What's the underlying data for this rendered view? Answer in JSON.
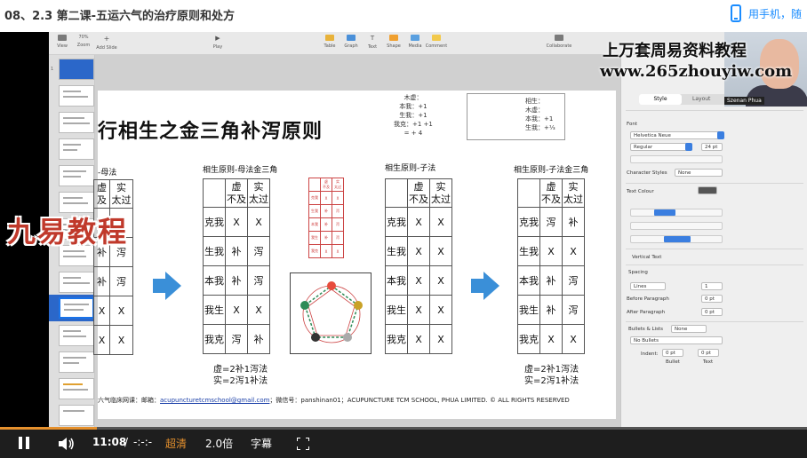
{
  "course_title": "08、2.3 第二课-五运六气的治疗原则和处方",
  "phone_link": "用手机，随",
  "toolbar": {
    "view": "View",
    "zoom": "Zoom",
    "zoom_value": "70%",
    "add_slide": "Add Slide",
    "play": "Play",
    "table": "Table",
    "graph": "Graph",
    "text": "Text",
    "shape": "Shape",
    "media": "Media",
    "comment": "Comment",
    "collaborate": "Collaborate"
  },
  "watermark": {
    "line1": "上万套周易资料教程",
    "line2": "www.265zhouyiw.com"
  },
  "presenter_name": "Szenan Phua",
  "logo_overlay": "九易教程",
  "slide": {
    "title": "行相生之金三角补泻原则",
    "note_left": [
      "木虚：",
      "本我：+1",
      "生我：+1",
      "我克：+1 +1",
      "= + 4"
    ],
    "note_right": [
      "相生：",
      "木虚：",
      "本我：+1",
      "生我：+⅓"
    ],
    "tables": [
      {
        "heading": "-母法",
        "headers": [
          "虚\n不及",
          "实\n太过"
        ],
        "rows": [
          [
            "",
            ""
          ],
          [
            "",
            ""
          ],
          [
            "补",
            "泻"
          ],
          [
            "补",
            "泻"
          ],
          [
            "X",
            "X"
          ],
          [
            "X",
            "X"
          ]
        ]
      },
      {
        "heading": "相生原则-母法金三角",
        "headers": [
          "虚\n不及",
          "实\n太过"
        ],
        "rows": [
          [
            "克我",
            "X",
            "X"
          ],
          [
            "生我",
            "补",
            "泻"
          ],
          [
            "本我",
            "补",
            "泻"
          ],
          [
            "我生",
            "X",
            "X"
          ],
          [
            "我克",
            "泻",
            "补"
          ]
        ]
      },
      {
        "heading": "相生原则-子法",
        "headers": [
          "虚\n不及",
          "实\n太过"
        ],
        "rows": [
          [
            "克我",
            "X",
            "X"
          ],
          [
            "生我",
            "X",
            "X"
          ],
          [
            "本我",
            "X",
            "X"
          ],
          [
            "我生",
            "X",
            "X"
          ],
          [
            "我克",
            "X",
            "X"
          ]
        ]
      },
      {
        "heading": "相生原则-子法金三角",
        "headers": [
          "虚\n不及",
          "实\n太过"
        ],
        "rows": [
          [
            "克我",
            "泻",
            "补"
          ],
          [
            "生我",
            "X",
            "X"
          ],
          [
            "本我",
            "补",
            "泻"
          ],
          [
            "我生",
            "补",
            "泻"
          ],
          [
            "我克",
            "X",
            "X"
          ]
        ]
      }
    ],
    "formula_left": [
      "虚=2补1泻法",
      "实=2泻1补法"
    ],
    "formula_right": [
      "虚=2补1泻法",
      "实=2泻1补法"
    ],
    "footer_prefix": "六气临床网课：邮箱：",
    "footer_email": "acupuncturetcmschool@gmail.com",
    "footer_suffix": "；微信号：panshinan01；ACUPUNCTURE TCM SCHOOL, PHUA LIMITED. © ALL RIGHTS RESERVED"
  },
  "inspector": {
    "tab_style": "Style",
    "tab_layout": "Layout",
    "font_label": "Font",
    "font_name": "Helvetica Neue",
    "font_weight": "Regular",
    "font_size": "24 pt",
    "character_styles": "Character Styles",
    "character_styles_value": "None",
    "text_colour": "Text Colour",
    "vertical_text": "Vertical Text",
    "spacing_label": "Spacing",
    "spacing_mode": "Lines",
    "spacing_value": "1",
    "before_paragraph": "Before Paragraph",
    "before_value": "0 pt",
    "after_paragraph": "After Paragraph",
    "after_value": "0 pt",
    "bullets_label": "Bullets & Lists",
    "bullets_value": "None",
    "bullets_type": "No Bullets",
    "indent_label": "Indent:",
    "bullet_label": "Bullet",
    "text_label": "Text",
    "indent_bullet": "0 pt",
    "indent_text": "0 pt"
  },
  "player": {
    "current_time": "11:08",
    "separator": "/",
    "duration": "-:-:-",
    "quality": "超清",
    "speed": "2.0倍",
    "subtitle": "字幕",
    "progress_fraction": 0.12
  },
  "colors": {
    "accent": "#1a8cff",
    "quality": "#e5902d",
    "arrow": "#3a8fd8"
  }
}
